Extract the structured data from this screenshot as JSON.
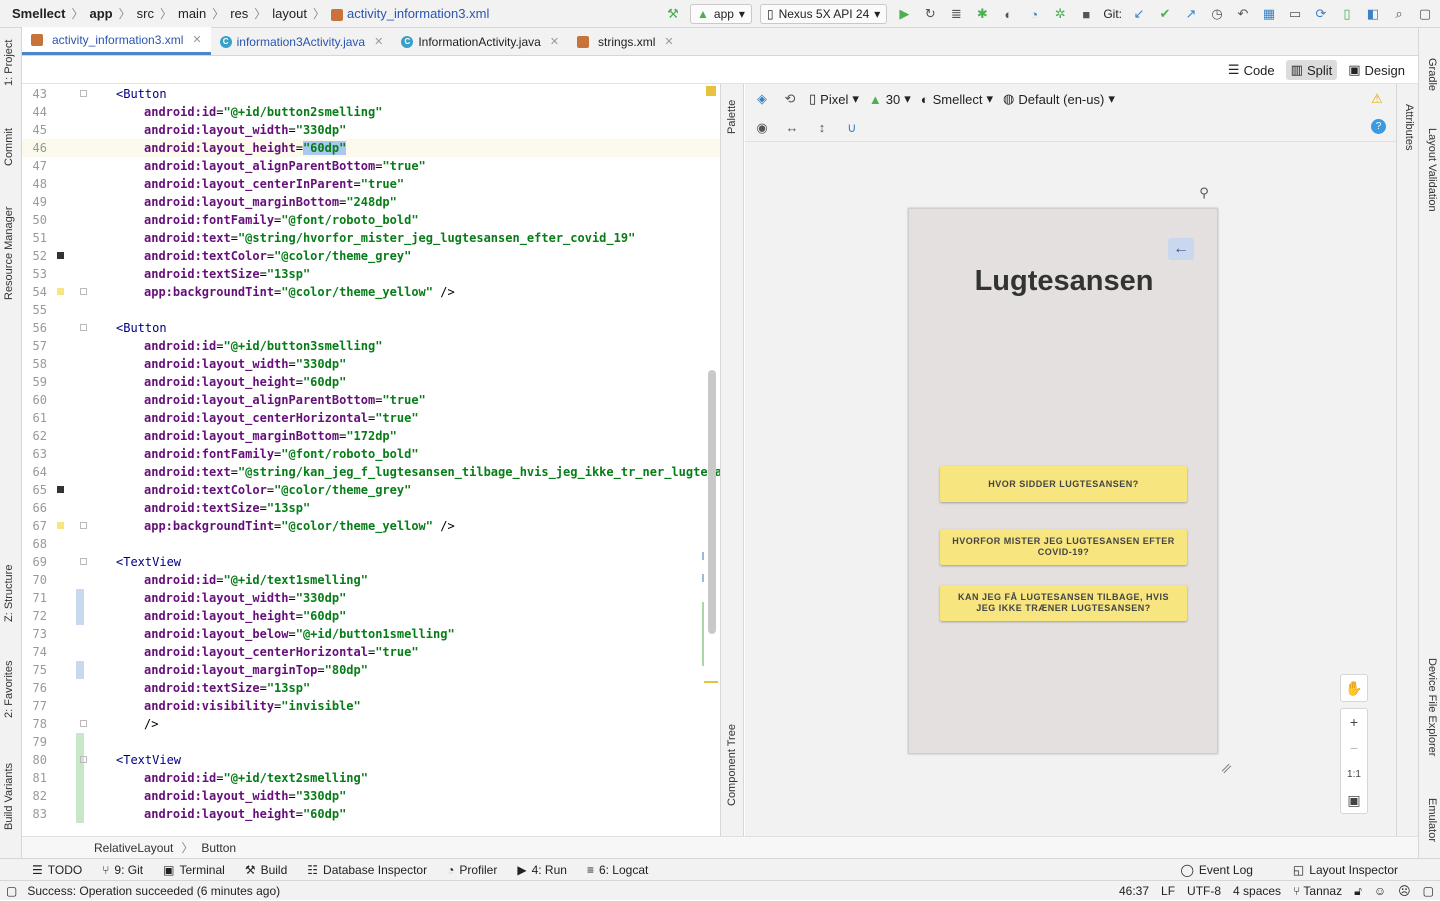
{
  "navbar": {
    "crumbs": [
      "Smellect",
      "app",
      "src",
      "main",
      "res",
      "layout"
    ],
    "file": "activity_information3.xml",
    "run_config": "app",
    "device": "Nexus 5X API 24",
    "git_label": "Git:"
  },
  "tabs": [
    {
      "label": "activity_information3.xml",
      "icon": "xml-file-icon"
    },
    {
      "label": "information3Activity.java",
      "icon": "java-class-icon"
    },
    {
      "label": "InformationActivity.java",
      "icon": "java-class-icon"
    },
    {
      "label": "strings.xml",
      "icon": "xml-file-icon"
    }
  ],
  "view_modes": {
    "code": "Code",
    "split": "Split",
    "design": "Design"
  },
  "left_tools": [
    "1: Project",
    "Commit",
    "Resource Manager",
    "Z: Structure",
    "2: Favorites",
    "Build Variants"
  ],
  "right_tools": [
    "Gradle",
    "Layout Validation",
    "Device File Explorer",
    "Emulator"
  ],
  "side_panels": {
    "palette": "Palette",
    "component_tree": "Component Tree",
    "attributes": "Attributes"
  },
  "design_toolbar": {
    "device": "Pixel",
    "api": "30",
    "theme": "Smellect",
    "locale": "Default (en-us)"
  },
  "preview": {
    "title": "Lugtesansen",
    "buttons": [
      "HVOR SIDDER LUGTESANSEN?",
      "HVORFOR MISTER JEG LUGTESANSEN EFTER COVID-19?",
      "KAN JEG FÅ LUGTESANSEN TILBAGE, HVIS JEG IKKE TRÆNER LUGTESANSEN?"
    ],
    "zoom_fit": "1:1"
  },
  "code_lines": [
    {
      "n": "43",
      "t": "<Button"
    },
    {
      "n": "44",
      "a": "android:id",
      "v": "\"@+id/button2smelling\""
    },
    {
      "n": "45",
      "a": "android:layout_width",
      "v": "\"330dp\""
    },
    {
      "n": "46",
      "a": "android:layout_height",
      "v": "\"60dp\""
    },
    {
      "n": "47",
      "a": "android:layout_alignParentBottom",
      "v": "\"true\""
    },
    {
      "n": "48",
      "a": "android:layout_centerInParent",
      "v": "\"true\""
    },
    {
      "n": "49",
      "a": "android:layout_marginBottom",
      "v": "\"248dp\""
    },
    {
      "n": "50",
      "a": "android:fontFamily",
      "v": "\"@font/roboto_bold\""
    },
    {
      "n": "51",
      "a": "android:text",
      "v": "\"@string/hvorfor_mister_jeg_lugtesansen_efter_covid_19\""
    },
    {
      "n": "52",
      "a": "android:textColor",
      "v": "\"@color/theme_grey\""
    },
    {
      "n": "53",
      "a": "android:textSize",
      "v": "\"13sp\""
    },
    {
      "n": "54",
      "a": "app:backgroundTint",
      "v": "\"@color/theme_yellow\"",
      "e": " />"
    },
    {
      "n": "55"
    },
    {
      "n": "56",
      "t": "<Button"
    },
    {
      "n": "57",
      "a": "android:id",
      "v": "\"@+id/button3smelling\""
    },
    {
      "n": "58",
      "a": "android:layout_width",
      "v": "\"330dp\""
    },
    {
      "n": "59",
      "a": "android:layout_height",
      "v": "\"60dp\""
    },
    {
      "n": "60",
      "a": "android:layout_alignParentBottom",
      "v": "\"true\""
    },
    {
      "n": "61",
      "a": "android:layout_centerHorizontal",
      "v": "\"true\""
    },
    {
      "n": "62",
      "a": "android:layout_marginBottom",
      "v": "\"172dp\""
    },
    {
      "n": "63",
      "a": "android:fontFamily",
      "v": "\"@font/roboto_bold\""
    },
    {
      "n": "64",
      "a": "android:text",
      "v": "\"@string/kan_jeg_f_lugtesansen_tilbage_hvis_jeg_ikke_tr_ner_lugtesans"
    },
    {
      "n": "65",
      "a": "android:textColor",
      "v": "\"@color/theme_grey\""
    },
    {
      "n": "66",
      "a": "android:textSize",
      "v": "\"13sp\""
    },
    {
      "n": "67",
      "a": "app:backgroundTint",
      "v": "\"@color/theme_yellow\"",
      "e": " />"
    },
    {
      "n": "68"
    },
    {
      "n": "69",
      "t": "<TextView"
    },
    {
      "n": "70",
      "a": "android:id",
      "v": "\"@+id/text1smelling\""
    },
    {
      "n": "71",
      "a": "android:layout_width",
      "v": "\"330dp\""
    },
    {
      "n": "72",
      "a": "android:layout_height",
      "v": "\"60dp\""
    },
    {
      "n": "73",
      "a": "android:layout_below",
      "v": "\"@+id/button1smelling\""
    },
    {
      "n": "74",
      "a": "android:layout_centerHorizontal",
      "v": "\"true\""
    },
    {
      "n": "75",
      "a": "android:layout_marginTop",
      "v": "\"80dp\""
    },
    {
      "n": "76",
      "a": "android:textSize",
      "v": "\"13sp\""
    },
    {
      "n": "77",
      "a": "android:visibility",
      "v": "\"invisible\""
    },
    {
      "n": "78",
      "p": "/>"
    },
    {
      "n": "79"
    },
    {
      "n": "80",
      "t": "<TextView"
    },
    {
      "n": "81",
      "a": "android:id",
      "v": "\"@+id/text2smelling\""
    },
    {
      "n": "82",
      "a": "android:layout_width",
      "v": "\"330dp\""
    },
    {
      "n": "83",
      "a": "android:layout_height",
      "v": "\"60dp\""
    }
  ],
  "path_bar": [
    "RelativeLayout",
    "Button"
  ],
  "bottom_tools": [
    {
      "label": "TODO",
      "icon": "list-icon"
    },
    {
      "label": "9: Git",
      "icon": "git-branch-icon"
    },
    {
      "label": "Terminal",
      "icon": "terminal-icon"
    },
    {
      "label": "Build",
      "icon": "build-icon"
    },
    {
      "label": "Database Inspector",
      "icon": "database-icon"
    },
    {
      "label": "Profiler",
      "icon": "profiler-icon"
    },
    {
      "label": "4: Run",
      "icon": "run-icon"
    },
    {
      "label": "6: Logcat",
      "icon": "logcat-icon"
    }
  ],
  "bottom_right_tools": [
    "Event Log",
    "Layout Inspector"
  ],
  "status": {
    "message": "Success: Operation succeeded (6 minutes ago)",
    "position": "46:37",
    "line_sep": "LF",
    "encoding": "UTF-8",
    "indent": "4 spaces",
    "user": "Tannaz"
  },
  "colors": {
    "accent": "#4a86c8",
    "button_yellow": "#f7e57f",
    "preview_bg": "#e3e0df"
  }
}
